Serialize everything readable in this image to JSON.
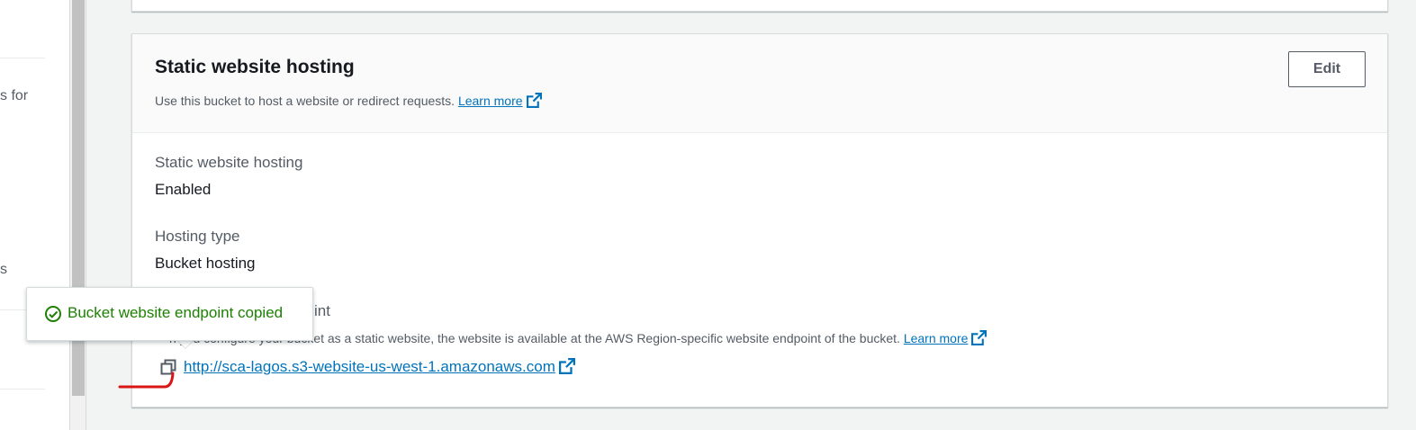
{
  "sidebar": {
    "fragment_1": "s for",
    "fragment_2": "s"
  },
  "static_website_hosting": {
    "title": "Static website hosting",
    "description": "Use this bucket to host a website or redirect requests.",
    "learn_more": "Learn more",
    "edit_label": "Edit",
    "fields": [
      {
        "label": "Static website hosting",
        "value": "Enabled"
      },
      {
        "label": "Hosting type",
        "value": "Bucket hosting"
      }
    ],
    "endpoint": {
      "label_visible": "int",
      "description_visible": "n you configure your bucket as a static website, the website is available at the AWS Region-specific website endpoint of the bucket.",
      "learn_more": "Learn more",
      "url": "http://sca-lagos.s3-website-us-west-1.amazonaws.com"
    }
  },
  "toast": {
    "message": "Bucket website endpoint copied"
  },
  "colors": {
    "link": "#0073bb",
    "success": "#1d8102",
    "annotation": "#d91515"
  },
  "icons": [
    "external-link-icon",
    "copy-icon",
    "check-circle-icon"
  ]
}
